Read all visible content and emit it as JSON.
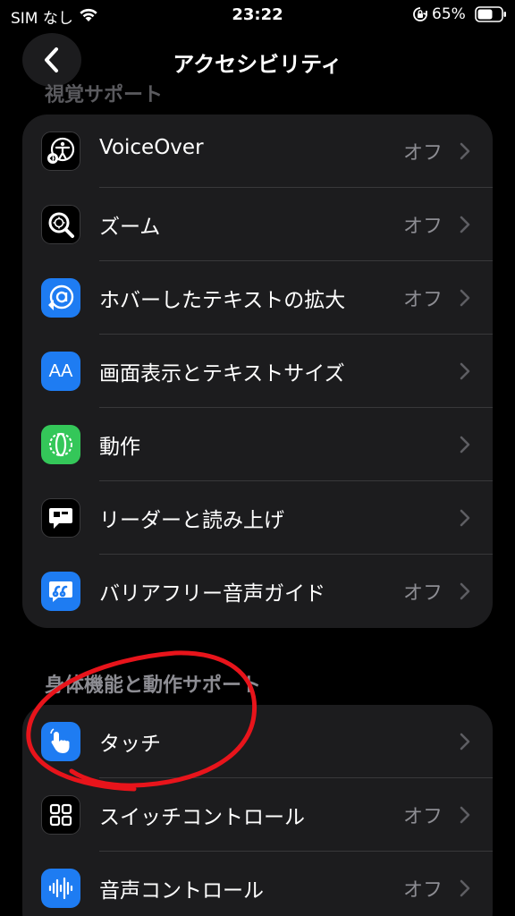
{
  "status_bar": {
    "carrier": "SIM なし",
    "time": "23:22",
    "battery_percent": "65%"
  },
  "nav": {
    "title": "アクセシビリティ",
    "back_icon": "chevron-left-icon"
  },
  "sections": {
    "vision_header": "視覚サポート",
    "physical_header": "身体機能と動作サポート"
  },
  "vision_items": [
    {
      "label": "VoiceOver",
      "value": "オフ",
      "icon": "voiceover-icon"
    },
    {
      "label": "ズーム",
      "value": "オフ",
      "icon": "zoom-icon"
    },
    {
      "label": "ホバーしたテキストの拡大",
      "value": "オフ",
      "icon": "hover-text-icon"
    },
    {
      "label": "画面表示とテキストサイズ",
      "value": "",
      "icon": "text-size-icon"
    },
    {
      "label": "動作",
      "value": "",
      "icon": "motion-icon"
    },
    {
      "label": "リーダーと読み上げ",
      "value": "",
      "icon": "spoken-content-icon"
    },
    {
      "label": "バリアフリー音声ガイド",
      "value": "オフ",
      "icon": "audio-description-icon"
    }
  ],
  "physical_items": [
    {
      "label": "タッチ",
      "value": "",
      "icon": "touch-icon"
    },
    {
      "label": "スイッチコントロール",
      "value": "オフ",
      "icon": "switch-control-icon"
    },
    {
      "label": "音声コントロール",
      "value": "オフ",
      "icon": "voice-control-icon"
    }
  ],
  "icon_glyphs": {
    "text_size": "AA"
  },
  "colors": {
    "background": "#000000",
    "group": "#1c1c1e",
    "secondary_text": "#8d8d93",
    "icon_blue": "#1e7cf2",
    "icon_green": "#34c759",
    "annotation_red": "#e8141b"
  }
}
